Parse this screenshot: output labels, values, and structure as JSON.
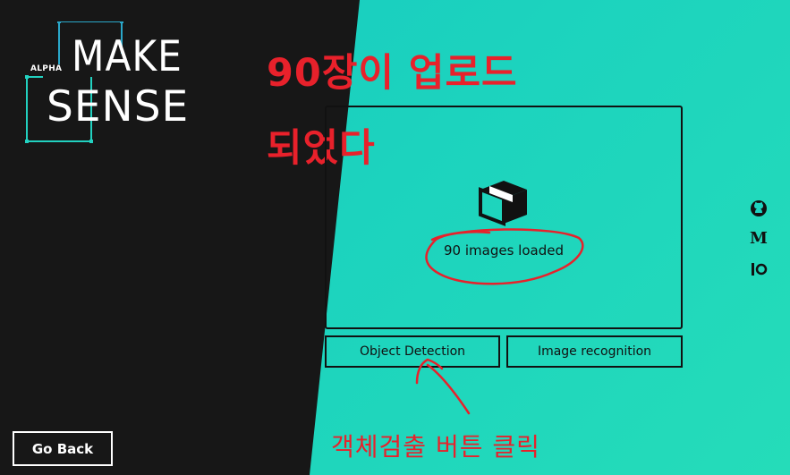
{
  "logo": {
    "alpha": "ALPHA",
    "line1": "MAKE",
    "line2": "SENSE"
  },
  "annotations": {
    "top_line1": "90장이 업로드",
    "top_line2": "되었다",
    "bottom": "객체검출 버튼 클릭"
  },
  "dropzone": {
    "icon": "box-icon",
    "status": "90 images loaded"
  },
  "buttons": {
    "object_detection": "Object Detection",
    "image_recognition": "Image recognition",
    "go_back": "Go Back"
  },
  "social": {
    "github": "github-icon",
    "medium": "M",
    "io": "io-icon"
  },
  "colors": {
    "dark_bg": "#171717",
    "teal_bg": "#1cd3be",
    "annotation_red": "#e8212b"
  }
}
